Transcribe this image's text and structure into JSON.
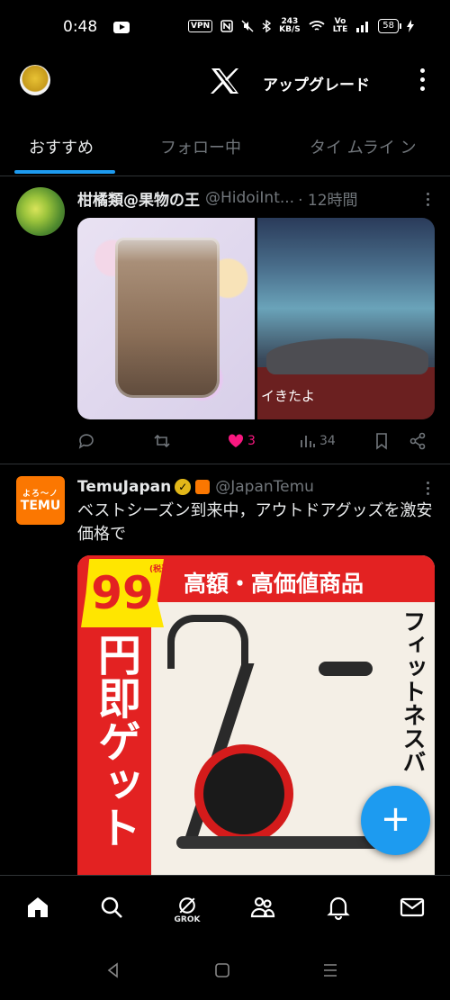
{
  "status_bar": {
    "time": "0:48",
    "vpn": "VPN",
    "net_speed_value": "243",
    "net_speed_unit": "KB/S",
    "lte_top": "Vo",
    "lte_bottom": "LTE",
    "battery": "58"
  },
  "header": {
    "upgrade_label": "アップグレード"
  },
  "tabs": [
    {
      "label": "おすすめ",
      "active": true
    },
    {
      "label": "フォロー中",
      "active": false
    },
    {
      "label": "タイ ムライ ン",
      "active": false
    }
  ],
  "posts": [
    {
      "author": "柑橘類@果物の王",
      "handle": "@HidoiInt...",
      "time": "· 12時間",
      "media_caption": "イきたよ",
      "actions": {
        "reply_count": "",
        "repost_count": "",
        "like_count": "3",
        "views_count": "34"
      }
    },
    {
      "author": "TemuJapan",
      "handle": "@JapanTemu",
      "avatar_top": "よろ〜ノ",
      "avatar_brand": "TEMU",
      "text": "ベストシーズン到来中，アウトドアグッズを激安価格で",
      "ad": {
        "price": "99",
        "tax_note": "(税込)",
        "banner": "高額・高価値商品",
        "vertical_left": "円即ゲット",
        "vertical_right": "フィットネスバ"
      }
    }
  ],
  "bottom_nav": {
    "grok_label": "GROK"
  },
  "colors": {
    "accent": "#1d9bf0",
    "like": "#f91880",
    "temu": "#fb7701"
  }
}
